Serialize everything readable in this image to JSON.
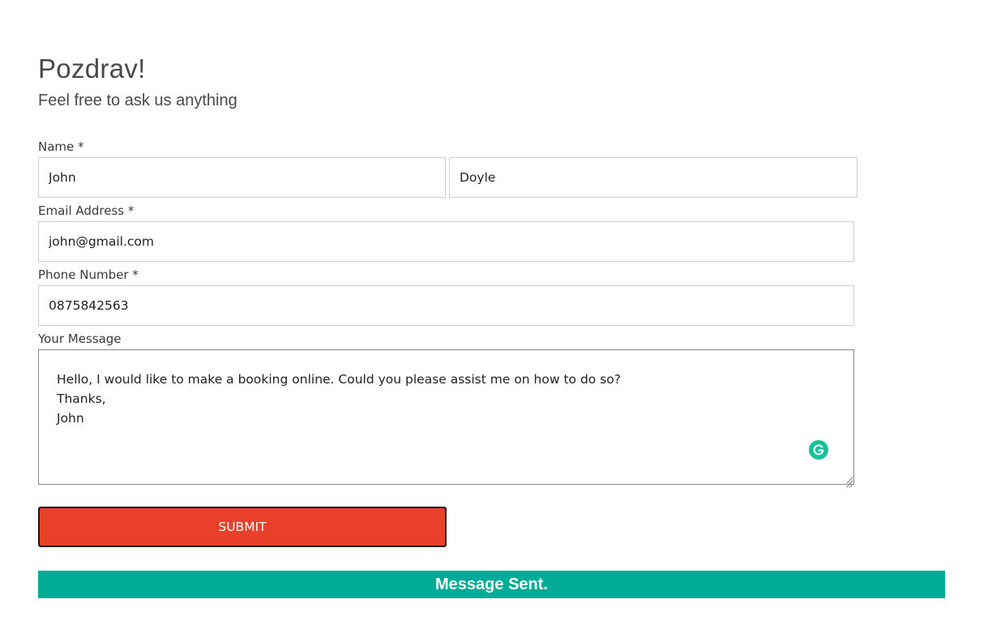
{
  "header": {
    "title": "Pozdrav!",
    "subtitle": "Feel free to ask us anything"
  },
  "form": {
    "name_label": "Name *",
    "first_name_value": "John",
    "last_name_value": "Doyle",
    "email_label": "Email Address *",
    "email_value": "john@gmail.com",
    "phone_label": "Phone Number *",
    "phone_value": "0875842563",
    "message_label": "Your Message",
    "message_value": "Hello, I would like to make a booking online. Could you please assist me on how to do so?\nThanks,\nJohn",
    "submit_label": "Submit"
  },
  "status": {
    "message": "Message Sent.",
    "color": "#00ab97"
  },
  "colors": {
    "submit_bg": "#e8402a",
    "grammarly": "#15c39a"
  },
  "icons": {
    "grammarly": "grammarly-icon",
    "resize": "resize-grip-icon"
  }
}
